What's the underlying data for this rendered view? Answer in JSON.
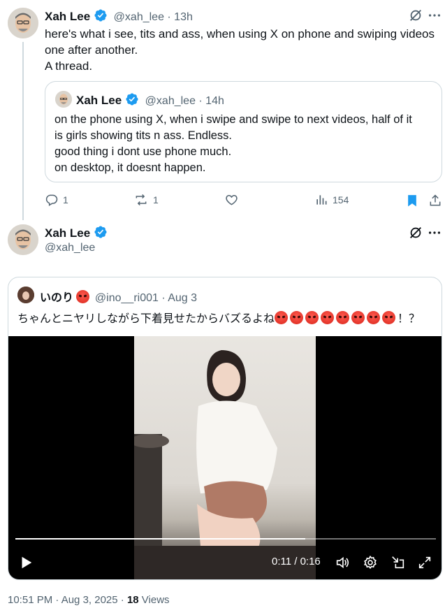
{
  "first_post": {
    "author_name": "Xah Lee",
    "handle_time": "@xah_lee · 13h",
    "text_lines": [
      "here's what i see, tits and ass, when using X on phone and swiping videos",
      "one after another.",
      "A thread."
    ]
  },
  "quoted_post": {
    "author_name": "Xah Lee",
    "handle_time": "@xah_lee · 14h",
    "text_lines": [
      "on the phone using X, when i swipe and swipe to next videos, half of it",
      "is girls showing tits n ass. Endless.",
      "good thing i dont use phone much.",
      "on desktop, it doesnt happen."
    ]
  },
  "actions": {
    "replies": "1",
    "reposts": "1",
    "views": "154"
  },
  "second_post": {
    "author_name": "Xah Lee",
    "handle": "@xah_lee"
  },
  "embedded_quote": {
    "author_name": "いのり",
    "handle_time": "@ino__ri001 · Aug 3",
    "text": "ちゃんとニヤリしながら下着見せたからバズるよね",
    "text_suffix": "！？",
    "emoji_count": 8
  },
  "video": {
    "time": "0:11 / 0:16",
    "progress": 0.69
  },
  "footer": {
    "timestamp": "10:51 PM · Aug 3, 2025 · ",
    "views_count": "18",
    "views_label": " Views"
  },
  "colors": {
    "accent": "#1d9bf0",
    "text": "#0f1419",
    "secondary": "#536471",
    "border": "#cfd9de"
  },
  "icons": [
    "verified-badge-icon",
    "grok-icon",
    "more-icon",
    "reply-icon",
    "repost-icon",
    "like-icon",
    "views-icon",
    "bookmark-icon",
    "share-icon",
    "play-icon",
    "volume-icon",
    "settings-icon",
    "dock-icon",
    "fullscreen-icon"
  ]
}
